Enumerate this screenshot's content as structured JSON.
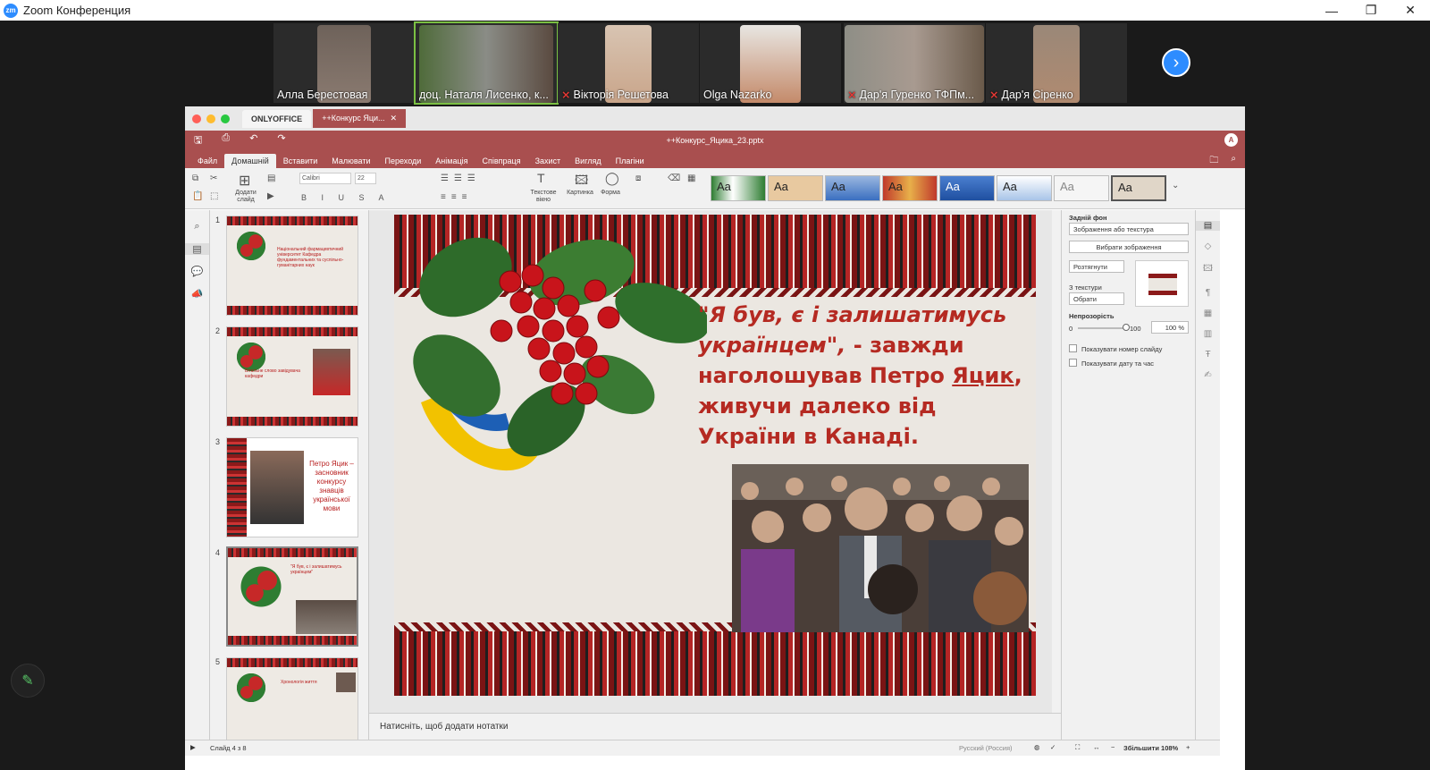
{
  "window": {
    "title": "Zoom Конференция",
    "logo_text": "zm",
    "controls": {
      "minimize": "—",
      "restore": "❐",
      "close": "✕"
    }
  },
  "participants": [
    {
      "name": "Алла Берестовая",
      "muted": false,
      "face_color": "#8a7a70"
    },
    {
      "name": "доц. Наталя Лисенко, к...",
      "muted": false,
      "active": true,
      "face_color": "#5a4a40"
    },
    {
      "name": "Вікторія Решетова",
      "muted": true,
      "face_color": "#c9a58a"
    },
    {
      "name": "Olga Nazarko",
      "muted": false,
      "face_color": "#c48a6a"
    },
    {
      "name": "Дар'я Гуренко ТФПм...",
      "muted": true,
      "face_color": "#9a8e86"
    },
    {
      "name": "Дар'я Сіренко",
      "muted": true,
      "face_color": "#b08a70"
    }
  ],
  "gallery_next_icon": "chevron-right-icon",
  "onlyoffice": {
    "brand": "ONLYOFFICE",
    "doc_tab": "++Конкурс Яци...",
    "doc_tab_close": "✕",
    "doc_name": "++Конкурс_Яцика_23.pptx",
    "avatar_letter": "А",
    "accent_color": "#a94f4f",
    "menu": [
      "Файл",
      "Домашній",
      "Вставити",
      "Малювати",
      "Переходи",
      "Анімація",
      "Співпраця",
      "Захист",
      "Вигляд",
      "Плагіни"
    ],
    "menu_active_index": 1,
    "ribbon": {
      "add_slide": "Додати слайд",
      "font_name": "Calibri",
      "font_size": "22",
      "textbox": "Текстове вікно",
      "picture": "Картинка",
      "shape": "Форма",
      "theme_sample": "Aa"
    },
    "slides": [
      {
        "num": "1",
        "title": "Національний фармацевтичний університет Кафедра фундаментальних та суспільно-гуманітарних наук"
      },
      {
        "num": "2",
        "title": "Вітальне слово завідувача кафедри"
      },
      {
        "num": "3",
        "title": "Петро Яцик – засновник конкурсу знавців української мови"
      },
      {
        "num": "4",
        "title": "\"Я був, є і залишатимусь українцем\""
      },
      {
        "num": "5",
        "title": "Хронологія життя"
      }
    ],
    "selected_slide": "4",
    "slide": {
      "quote_italic": "\"Я був, є і залишатимусь українцем\",",
      "quote_rest_1": " - завжди наголошував Петро ",
      "quote_underline": "Яцик",
      "quote_rest_2": ", живучи далеко від України в Канаді."
    },
    "notes_placeholder": "Натисніть, щоб додати нотатки",
    "right_panel": {
      "background_label": "Задній фон",
      "fill_type": "Зображення або текстура",
      "choose_image": "Вибрати зображення",
      "stretch": "Розтягнути",
      "from_texture_label": "З текстури",
      "choose": "Обрати",
      "opacity_label": "Непрозорість",
      "opacity_min": "0",
      "opacity_max": "100",
      "opacity_value": "100 %",
      "show_slide_number": "Показувати номер слайду",
      "show_date_time": "Показувати дату та час"
    },
    "status": {
      "slide_counter": "Слайд 4 з 8",
      "language": "Русский (Россия)",
      "zoom": "Збільшити 108%"
    }
  }
}
